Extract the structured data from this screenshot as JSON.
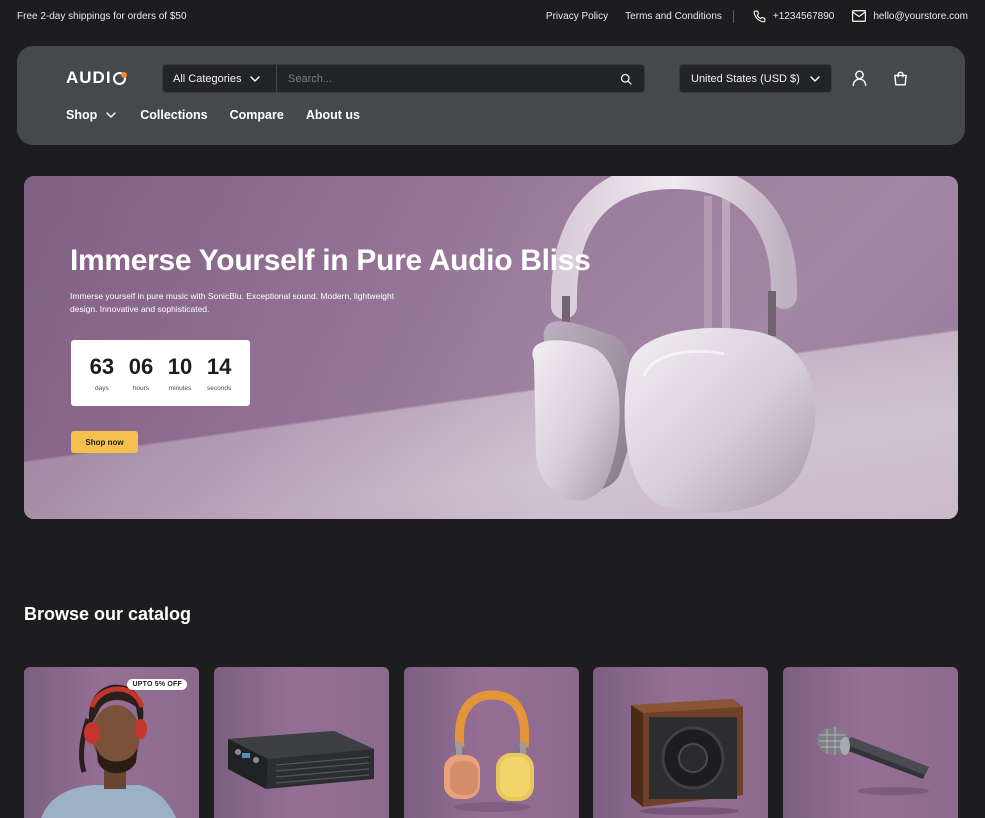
{
  "topbar": {
    "promo": "Free 2-day shippings for orders of $50",
    "links": [
      "Privacy Policy",
      "Terms and Conditions"
    ],
    "phone": "+1234567890",
    "email": "hello@yourstore.com"
  },
  "header": {
    "logo": "AUDI",
    "category_select": "All Categories",
    "search_placeholder": "Search...",
    "currency": "United States (USD $)",
    "nav": [
      "Shop",
      "Collections",
      "Compare",
      "About us"
    ]
  },
  "hero": {
    "title": "Immerse Yourself in Pure Audio Bliss",
    "subtitle": "Immerse yourself in pure music with SonicBlu. Exceptional sound. Modern, lightweight design. Innovative and sophisticated.",
    "countdown": [
      {
        "value": "63",
        "label": "days"
      },
      {
        "value": "06",
        "label": "hours"
      },
      {
        "value": "10",
        "label": "minutes"
      },
      {
        "value": "14",
        "label": "seconds"
      }
    ],
    "cta": "Shop now"
  },
  "catalog": {
    "title": "Browse our catalog",
    "cards": [
      {
        "image": "man-with-headphones",
        "badge": "UPTO 5% OFF"
      },
      {
        "image": "amplifier"
      },
      {
        "image": "orange-headphones"
      },
      {
        "image": "subwoofer-speaker"
      },
      {
        "image": "microphone"
      }
    ]
  },
  "colors": {
    "page_bg": "#1d1d1f",
    "header_bg": "#46494c",
    "accent_cta": "#f6c04f",
    "hero_bg": "#9a7a9b"
  }
}
